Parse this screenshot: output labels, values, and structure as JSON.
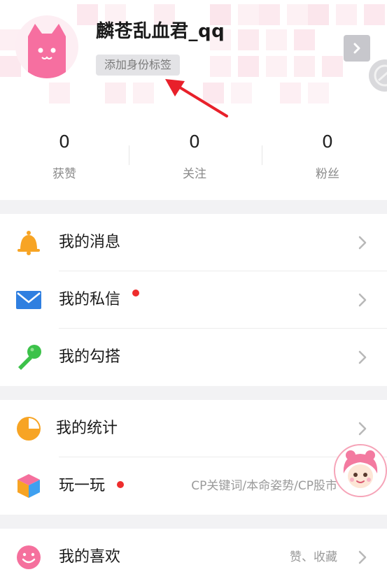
{
  "profile": {
    "username": "麟苍乱血君_qq",
    "identity_tag": "添加身份标签"
  },
  "stats": [
    {
      "value": "0",
      "label": "获赞"
    },
    {
      "value": "0",
      "label": "关注"
    },
    {
      "value": "0",
      "label": "粉丝"
    }
  ],
  "menu_group_1": [
    {
      "label": "我的消息",
      "icon": "bell-icon",
      "has_dot": false
    },
    {
      "label": "我的私信",
      "icon": "mail-icon",
      "has_dot": true
    },
    {
      "label": "我的勾搭",
      "icon": "microphone-icon",
      "has_dot": false
    }
  ],
  "menu_group_2": [
    {
      "label": "我的统计",
      "icon": "pie-chart-icon",
      "has_dot": false
    },
    {
      "label": "玩一玩",
      "icon": "cube-icon",
      "has_dot": true,
      "subtitle": "CP关键词/本命姿势/CP股市"
    }
  ],
  "menu_group_3": [
    {
      "label": "我的喜欢",
      "icon": "smiley-icon",
      "has_dot": false,
      "subtitle": "赞、收藏"
    }
  ],
  "colors": {
    "accent_pink": "#f5709d",
    "notification_red": "#ee2d2d",
    "bell_orange": "#f7a424",
    "mail_blue": "#2f7fe0",
    "mic_green": "#3cc24a"
  }
}
